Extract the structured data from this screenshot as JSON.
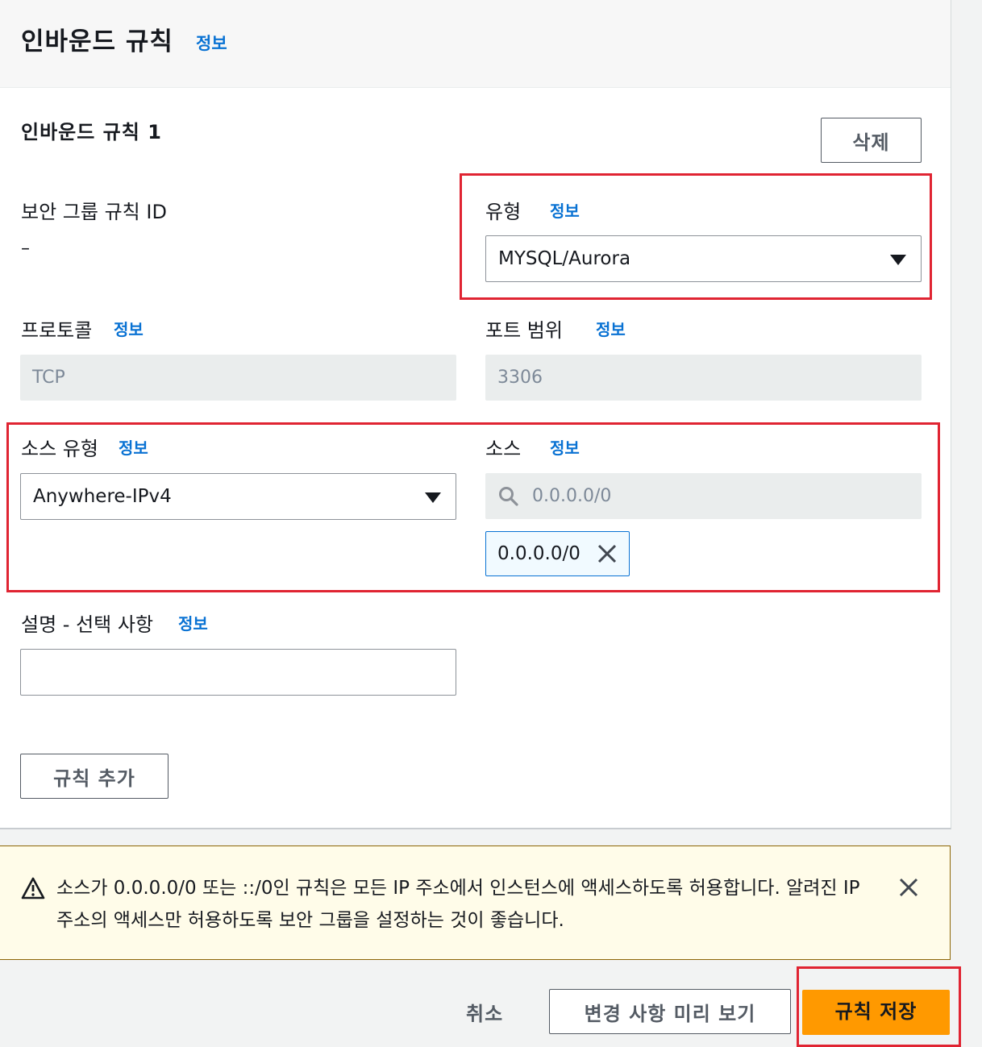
{
  "header": {
    "title": "인바운드 규칙",
    "info": "정보"
  },
  "rule": {
    "title": "인바운드 규칙 1",
    "delete_label": "삭제",
    "sg_rule_id_label": "보안 그룹 규칙 ID",
    "sg_rule_id_value": "–",
    "type_label": "유형",
    "type_info": "정보",
    "type_value": "MYSQL/Aurora",
    "protocol_label": "프로토콜",
    "protocol_info": "정보",
    "protocol_value": "TCP",
    "port_label": "포트 범위",
    "port_info": "정보",
    "port_value": "3306",
    "source_type_label": "소스 유형",
    "source_type_info": "정보",
    "source_type_value": "Anywhere-IPv4",
    "source_label": "소스",
    "source_info": "정보",
    "source_search_placeholder": "0.0.0.0/0",
    "source_token": "0.0.0.0/0",
    "desc_label": "설명 - 선택 사항",
    "desc_info": "정보",
    "desc_value": ""
  },
  "add_rule_label": "규칙 추가",
  "alert": {
    "text": "소스가 0.0.0.0/0 또는 ::/0인 규칙은 모든 IP 주소에서 인스턴스에 액세스하도록 허용합니다. 알려진 IP 주소의 액세스만 허용하도록 보안 그룹을 설정하는 것이 좋습니다."
  },
  "footer": {
    "cancel_label": "취소",
    "preview_label": "변경 사항 미리 보기",
    "save_label": "규칙 저장"
  },
  "colors": {
    "link": "#0972d3",
    "primary": "#ff9900",
    "highlight": "#e02432",
    "warning_bg": "#fffce9"
  }
}
